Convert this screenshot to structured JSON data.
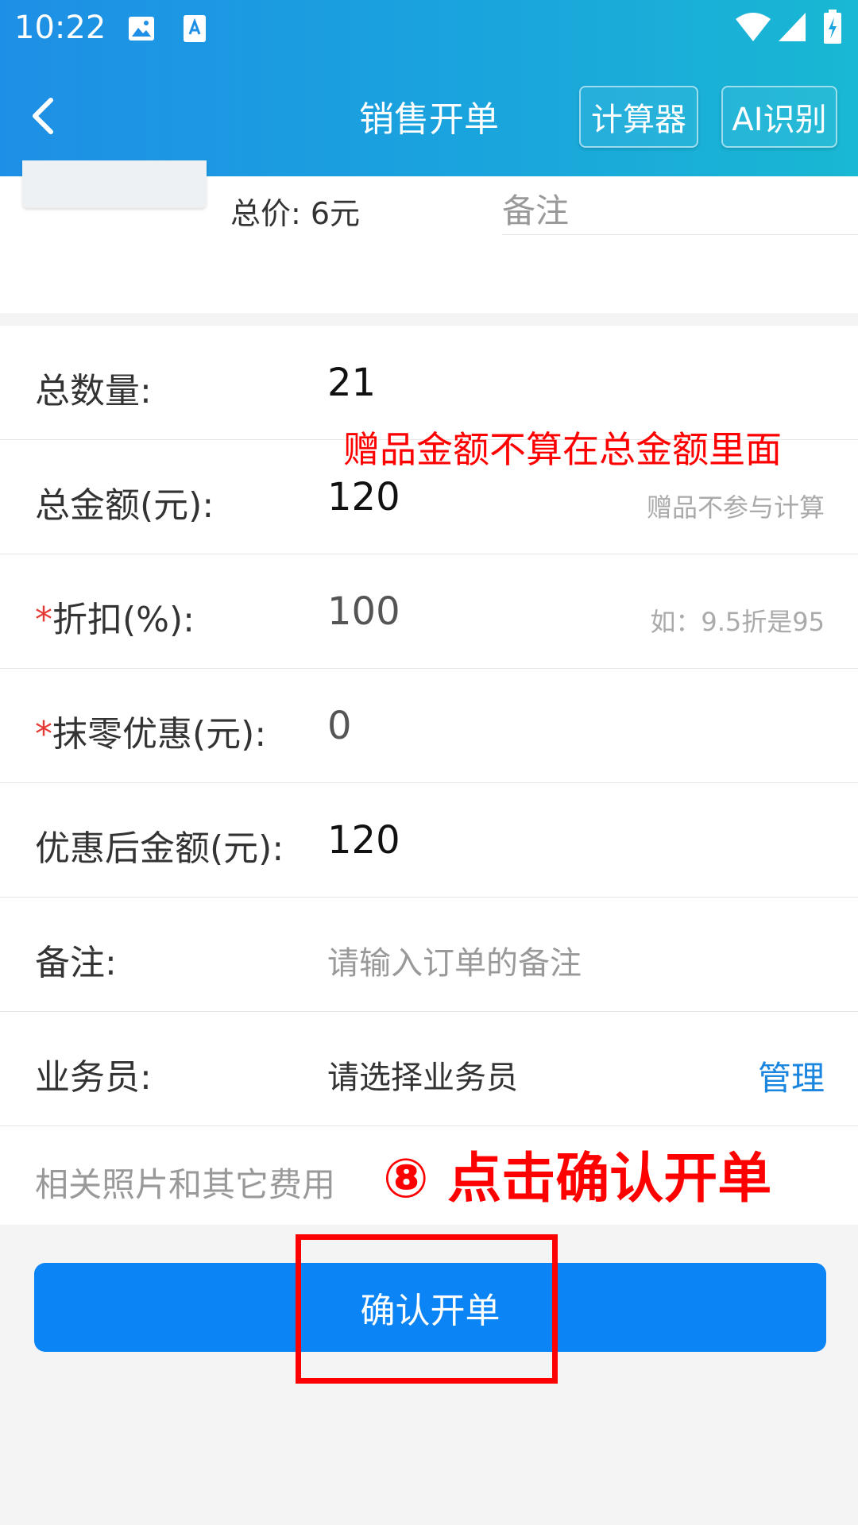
{
  "status_bar": {
    "time": "10:22"
  },
  "navbar": {
    "title": "销售开单",
    "calculator_label": "计算器",
    "ai_label": "AI识别"
  },
  "product": {
    "total_price": "总价: 6元",
    "remark_placeholder": "备注"
  },
  "form": {
    "total_qty_label": "总数量:",
    "total_qty_value": "21",
    "total_amount_label": "总金额(元):",
    "total_amount_value": "120",
    "total_amount_hint": "赠品不参与计算",
    "discount_required": "*",
    "discount_label": "折扣(%):",
    "discount_value": "100",
    "discount_hint": "如：9.5折是95",
    "rounding_required": "*",
    "rounding_label": "抹零优惠(元):",
    "rounding_value": "0",
    "after_discount_label": "优惠后金额(元):",
    "after_discount_value": "120",
    "remark_label": "备注:",
    "remark_placeholder": "请输入订单的备注",
    "salesman_label": "业务员:",
    "salesman_placeholder": "请选择业务员",
    "salesman_manage": "管理",
    "photos_label": "相关照片和其它费用"
  },
  "confirm_button": "确认开单",
  "annotations": {
    "gift_note": "赠品金额不算在总金额里面",
    "step_note": "⑧ 点击确认开单"
  },
  "colors": {
    "header_start": "#1e8fe6",
    "header_end": "#19b8d3",
    "primary": "#0b84f5",
    "required": "#e53935",
    "annotation": "#ff0000",
    "link": "#1a86e0"
  }
}
